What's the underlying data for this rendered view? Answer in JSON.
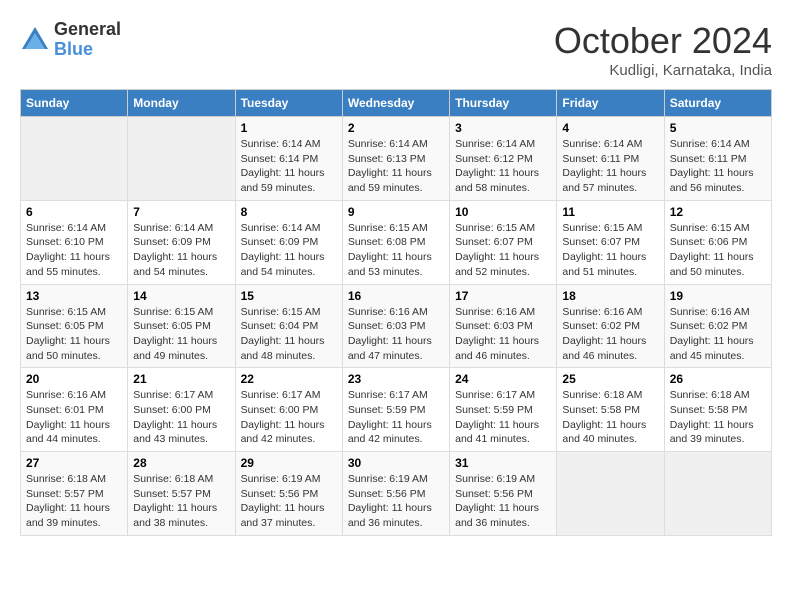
{
  "logo": {
    "general": "General",
    "blue": "Blue"
  },
  "header": {
    "month": "October 2024",
    "location": "Kudligi, Karnataka, India"
  },
  "weekdays": [
    "Sunday",
    "Monday",
    "Tuesday",
    "Wednesday",
    "Thursday",
    "Friday",
    "Saturday"
  ],
  "weeks": [
    [
      {
        "day": "",
        "sunrise": "",
        "sunset": "",
        "daylight": "",
        "empty": true
      },
      {
        "day": "",
        "sunrise": "",
        "sunset": "",
        "daylight": "",
        "empty": true
      },
      {
        "day": "1",
        "sunrise": "Sunrise: 6:14 AM",
        "sunset": "Sunset: 6:14 PM",
        "daylight": "Daylight: 11 hours and 59 minutes."
      },
      {
        "day": "2",
        "sunrise": "Sunrise: 6:14 AM",
        "sunset": "Sunset: 6:13 PM",
        "daylight": "Daylight: 11 hours and 59 minutes."
      },
      {
        "day": "3",
        "sunrise": "Sunrise: 6:14 AM",
        "sunset": "Sunset: 6:12 PM",
        "daylight": "Daylight: 11 hours and 58 minutes."
      },
      {
        "day": "4",
        "sunrise": "Sunrise: 6:14 AM",
        "sunset": "Sunset: 6:11 PM",
        "daylight": "Daylight: 11 hours and 57 minutes."
      },
      {
        "day": "5",
        "sunrise": "Sunrise: 6:14 AM",
        "sunset": "Sunset: 6:11 PM",
        "daylight": "Daylight: 11 hours and 56 minutes."
      }
    ],
    [
      {
        "day": "6",
        "sunrise": "Sunrise: 6:14 AM",
        "sunset": "Sunset: 6:10 PM",
        "daylight": "Daylight: 11 hours and 55 minutes."
      },
      {
        "day": "7",
        "sunrise": "Sunrise: 6:14 AM",
        "sunset": "Sunset: 6:09 PM",
        "daylight": "Daylight: 11 hours and 54 minutes."
      },
      {
        "day": "8",
        "sunrise": "Sunrise: 6:14 AM",
        "sunset": "Sunset: 6:09 PM",
        "daylight": "Daylight: 11 hours and 54 minutes."
      },
      {
        "day": "9",
        "sunrise": "Sunrise: 6:15 AM",
        "sunset": "Sunset: 6:08 PM",
        "daylight": "Daylight: 11 hours and 53 minutes."
      },
      {
        "day": "10",
        "sunrise": "Sunrise: 6:15 AM",
        "sunset": "Sunset: 6:07 PM",
        "daylight": "Daylight: 11 hours and 52 minutes."
      },
      {
        "day": "11",
        "sunrise": "Sunrise: 6:15 AM",
        "sunset": "Sunset: 6:07 PM",
        "daylight": "Daylight: 11 hours and 51 minutes."
      },
      {
        "day": "12",
        "sunrise": "Sunrise: 6:15 AM",
        "sunset": "Sunset: 6:06 PM",
        "daylight": "Daylight: 11 hours and 50 minutes."
      }
    ],
    [
      {
        "day": "13",
        "sunrise": "Sunrise: 6:15 AM",
        "sunset": "Sunset: 6:05 PM",
        "daylight": "Daylight: 11 hours and 50 minutes."
      },
      {
        "day": "14",
        "sunrise": "Sunrise: 6:15 AM",
        "sunset": "Sunset: 6:05 PM",
        "daylight": "Daylight: 11 hours and 49 minutes."
      },
      {
        "day": "15",
        "sunrise": "Sunrise: 6:15 AM",
        "sunset": "Sunset: 6:04 PM",
        "daylight": "Daylight: 11 hours and 48 minutes."
      },
      {
        "day": "16",
        "sunrise": "Sunrise: 6:16 AM",
        "sunset": "Sunset: 6:03 PM",
        "daylight": "Daylight: 11 hours and 47 minutes."
      },
      {
        "day": "17",
        "sunrise": "Sunrise: 6:16 AM",
        "sunset": "Sunset: 6:03 PM",
        "daylight": "Daylight: 11 hours and 46 minutes."
      },
      {
        "day": "18",
        "sunrise": "Sunrise: 6:16 AM",
        "sunset": "Sunset: 6:02 PM",
        "daylight": "Daylight: 11 hours and 46 minutes."
      },
      {
        "day": "19",
        "sunrise": "Sunrise: 6:16 AM",
        "sunset": "Sunset: 6:02 PM",
        "daylight": "Daylight: 11 hours and 45 minutes."
      }
    ],
    [
      {
        "day": "20",
        "sunrise": "Sunrise: 6:16 AM",
        "sunset": "Sunset: 6:01 PM",
        "daylight": "Daylight: 11 hours and 44 minutes."
      },
      {
        "day": "21",
        "sunrise": "Sunrise: 6:17 AM",
        "sunset": "Sunset: 6:00 PM",
        "daylight": "Daylight: 11 hours and 43 minutes."
      },
      {
        "day": "22",
        "sunrise": "Sunrise: 6:17 AM",
        "sunset": "Sunset: 6:00 PM",
        "daylight": "Daylight: 11 hours and 42 minutes."
      },
      {
        "day": "23",
        "sunrise": "Sunrise: 6:17 AM",
        "sunset": "Sunset: 5:59 PM",
        "daylight": "Daylight: 11 hours and 42 minutes."
      },
      {
        "day": "24",
        "sunrise": "Sunrise: 6:17 AM",
        "sunset": "Sunset: 5:59 PM",
        "daylight": "Daylight: 11 hours and 41 minutes."
      },
      {
        "day": "25",
        "sunrise": "Sunrise: 6:18 AM",
        "sunset": "Sunset: 5:58 PM",
        "daylight": "Daylight: 11 hours and 40 minutes."
      },
      {
        "day": "26",
        "sunrise": "Sunrise: 6:18 AM",
        "sunset": "Sunset: 5:58 PM",
        "daylight": "Daylight: 11 hours and 39 minutes."
      }
    ],
    [
      {
        "day": "27",
        "sunrise": "Sunrise: 6:18 AM",
        "sunset": "Sunset: 5:57 PM",
        "daylight": "Daylight: 11 hours and 39 minutes."
      },
      {
        "day": "28",
        "sunrise": "Sunrise: 6:18 AM",
        "sunset": "Sunset: 5:57 PM",
        "daylight": "Daylight: 11 hours and 38 minutes."
      },
      {
        "day": "29",
        "sunrise": "Sunrise: 6:19 AM",
        "sunset": "Sunset: 5:56 PM",
        "daylight": "Daylight: 11 hours and 37 minutes."
      },
      {
        "day": "30",
        "sunrise": "Sunrise: 6:19 AM",
        "sunset": "Sunset: 5:56 PM",
        "daylight": "Daylight: 11 hours and 36 minutes."
      },
      {
        "day": "31",
        "sunrise": "Sunrise: 6:19 AM",
        "sunset": "Sunset: 5:56 PM",
        "daylight": "Daylight: 11 hours and 36 minutes."
      },
      {
        "day": "",
        "sunrise": "",
        "sunset": "",
        "daylight": "",
        "empty": true
      },
      {
        "day": "",
        "sunrise": "",
        "sunset": "",
        "daylight": "",
        "empty": true
      }
    ]
  ]
}
